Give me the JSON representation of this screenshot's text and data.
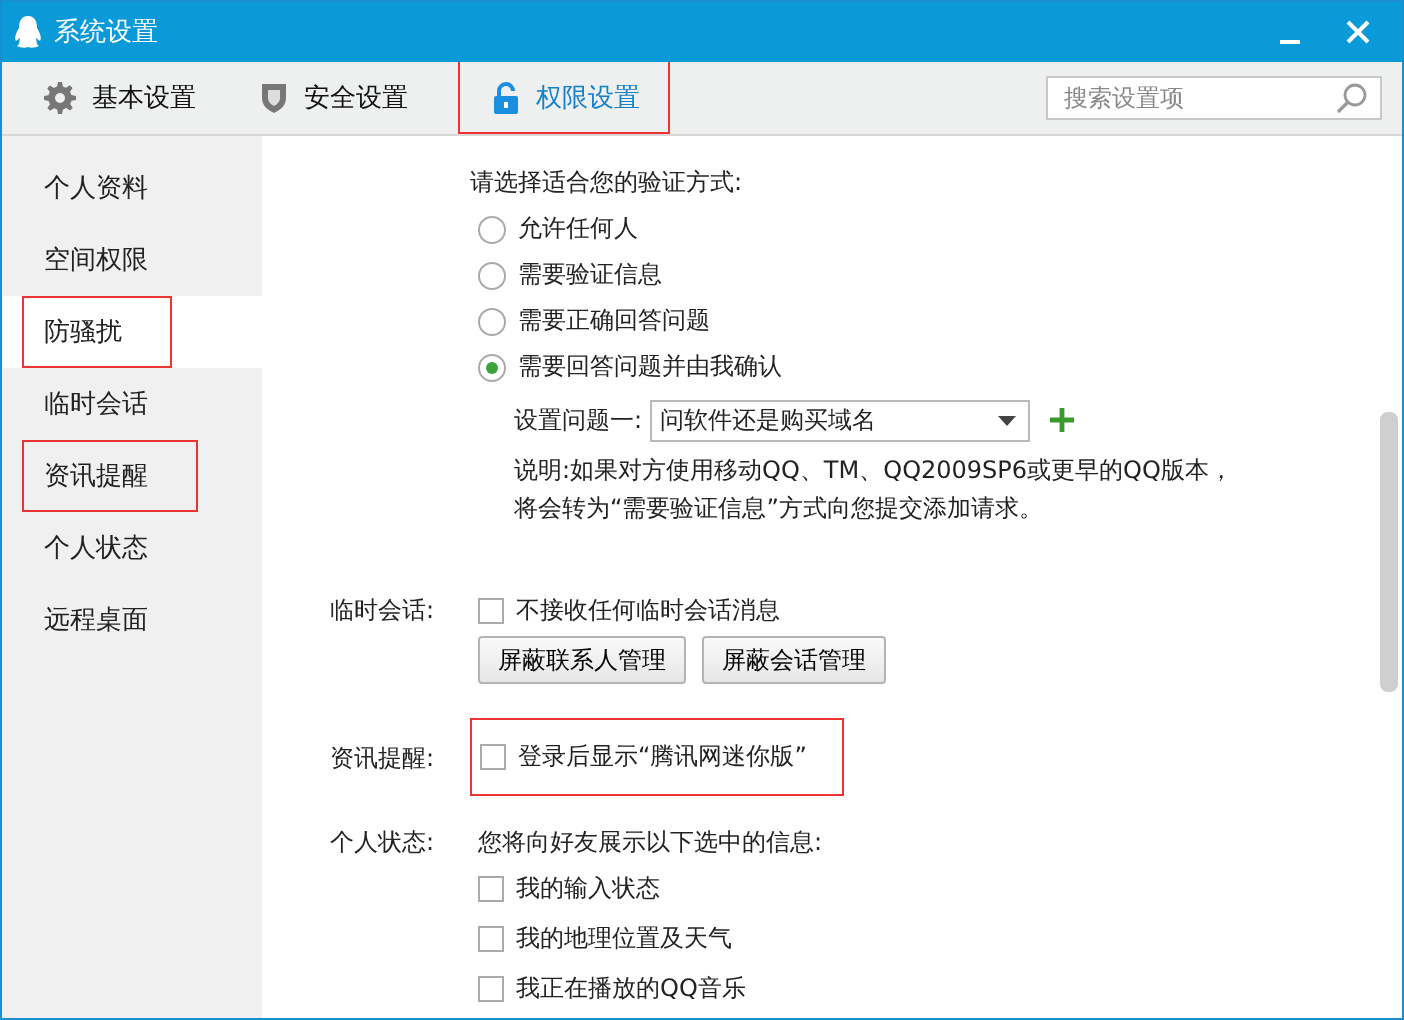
{
  "window": {
    "title": "系统设置"
  },
  "tabs": [
    {
      "label": "基本设置",
      "kind": "gear",
      "selected": false,
      "marked": false
    },
    {
      "label": "安全设置",
      "kind": "shield",
      "selected": false,
      "marked": false
    },
    {
      "label": "权限设置",
      "kind": "lock",
      "selected": true,
      "marked": true
    }
  ],
  "search": {
    "placeholder": "搜索设置项"
  },
  "sidebar": {
    "items": [
      {
        "label": "个人资料",
        "selected": false,
        "marked": false
      },
      {
        "label": "空间权限",
        "selected": false,
        "marked": false
      },
      {
        "label": "防骚扰",
        "selected": true,
        "marked": true
      },
      {
        "label": "临时会话",
        "selected": false,
        "marked": false
      },
      {
        "label": "资讯提醒",
        "selected": false,
        "marked": true
      },
      {
        "label": "个人状态",
        "selected": false,
        "marked": false
      },
      {
        "label": "远程桌面",
        "selected": false,
        "marked": false
      }
    ]
  },
  "verification": {
    "prompt": "请选择适合您的验证方式:",
    "options": [
      {
        "label": "允许任何人",
        "selected": false
      },
      {
        "label": "需要验证信息",
        "selected": false
      },
      {
        "label": "需要正确回答问题",
        "selected": false
      },
      {
        "label": "需要回答问题并由我确认",
        "selected": true
      }
    ],
    "question": {
      "label": "设置问题一:",
      "value": "问软件还是购买域名"
    },
    "note": "说明:如果对方使用移动QQ、TM、QQ2009SP6或更早的QQ版本，将会转为“需要验证信息”方式向您提交添加请求。"
  },
  "temp_session": {
    "label": "临时会话:",
    "checkbox": {
      "label": "不接收任何临时会话消息",
      "checked": false
    },
    "buttons": [
      "屏蔽联系人管理",
      "屏蔽会话管理"
    ]
  },
  "news": {
    "label": "资讯提醒:",
    "marked": true,
    "checkbox": {
      "label": "登录后显示“腾讯网迷你版”",
      "checked": false
    }
  },
  "status": {
    "label": "个人状态:",
    "prompt": "您将向好友展示以下选中的信息:",
    "options": [
      {
        "label": "我的输入状态",
        "checked": false
      },
      {
        "label": "我的地理位置及天气",
        "checked": false
      },
      {
        "label": "我正在播放的QQ音乐",
        "checked": false
      }
    ]
  }
}
